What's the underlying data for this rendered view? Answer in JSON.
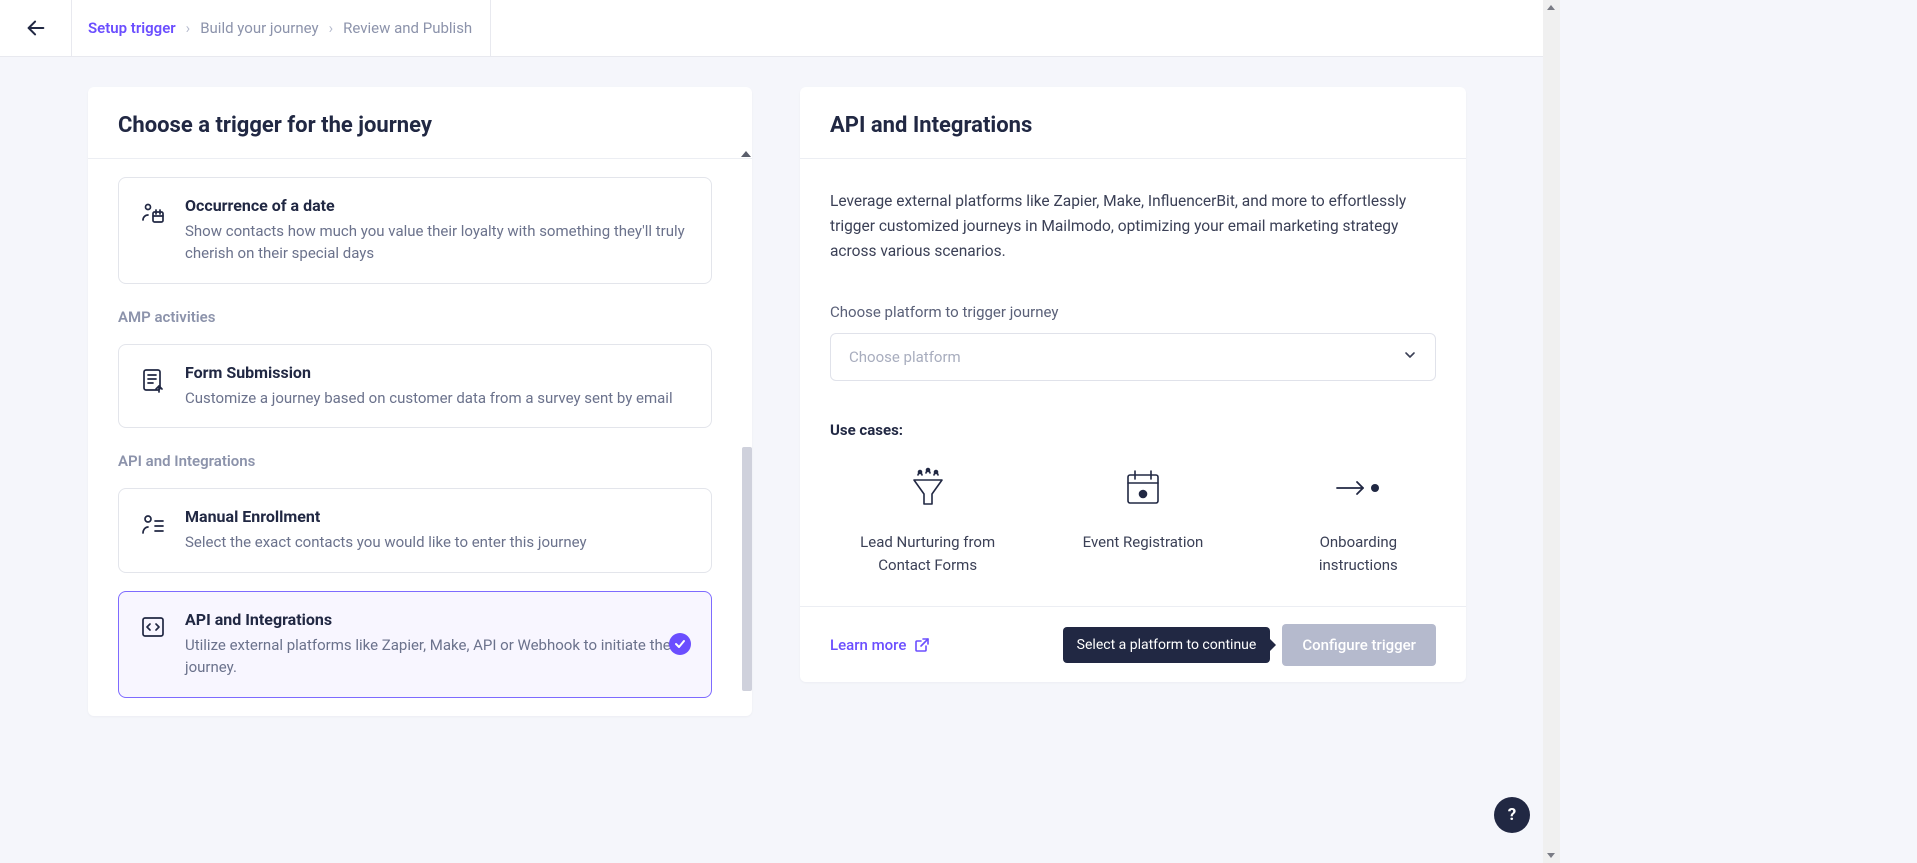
{
  "breadcrumb": {
    "steps": [
      "Setup trigger",
      "Build your journey",
      "Review and Publish"
    ],
    "active_index": 0
  },
  "left_panel": {
    "title": "Choose a trigger for the journey",
    "triggers": [
      {
        "title": "Occurrence of a date",
        "desc": "Show contacts how much you value their loyalty with something they'll truly cherish on their special days",
        "icon": "person-calendar-icon"
      }
    ],
    "sections": [
      {
        "label": "AMP activities",
        "items": [
          {
            "title": "Form Submission",
            "desc": "Customize a journey based on customer data from a survey sent by email",
            "icon": "form-upload-icon"
          }
        ]
      },
      {
        "label": "API and Integrations",
        "items": [
          {
            "title": "Manual Enrollment",
            "desc": "Select the exact contacts you would like to enter this journey",
            "icon": "person-list-icon"
          },
          {
            "title": "API and Integrations",
            "desc": "Utilize external platforms like Zapier, Make, API or Webhook to initiate the journey.",
            "icon": "code-box-icon",
            "selected": true
          }
        ]
      }
    ]
  },
  "right_panel": {
    "title": "API and Integrations",
    "description": "Leverage external platforms like Zapier, Make, InfluencerBit, and more to effortlessly trigger customized journeys in Mailmodo, optimizing your email marketing strategy across various scenarios.",
    "platform_label": "Choose platform to trigger journey",
    "platform_placeholder": "Choose platform",
    "use_cases_label": "Use cases:",
    "use_cases": [
      {
        "label": "Lead Nurturing from Contact Forms",
        "icon": "funnel-people-icon"
      },
      {
        "label": "Event Registration",
        "icon": "calendar-dot-icon"
      },
      {
        "label": "Onboarding instructions",
        "icon": "arrow-dot-icon"
      }
    ],
    "learn_more": "Learn more",
    "tooltip": "Select a platform to continue",
    "cta_button": "Configure trigger"
  },
  "help": "?"
}
